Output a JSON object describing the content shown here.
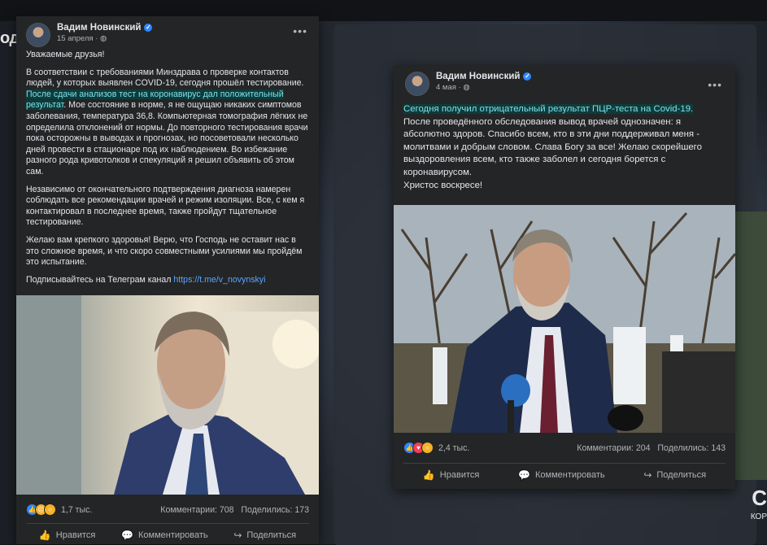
{
  "watermark_left": "ода",
  "watermark_right": {
    "big": "С",
    "small": "КОР"
  },
  "post1": {
    "author": "Вадим Новинский",
    "date": "15 апреля · ",
    "paragraphs": {
      "greeting": "Уважаемые друзья!",
      "p2_part1": "В соответствии с требованиями Минздрава о проверке контактов людей, у которых выявлен COVID-19, сегодня прошёл тестирование. ",
      "p2_highlight": "После сдачи анализов тест на коронавирус дал положительный результат",
      "p2_part2": ". Мое состояние в норме, я не ощущаю никаких симптомов заболевания, температура 36,8. Компьютерная томография лёгких не определила отклонений от нормы. До повторного тестирования врачи пока осторожны в выводах и прогнозах, но посоветовали несколько дней провести в стационаре под их наблюдением. Во избежание разного рода кривотолков и спекуляций я решил объявить об этом сам.",
      "p3": "Независимо от окончательного подтверждения диагноза намерен соблюдать все рекомендации врачей и режим изоляции. Все, с кем я контактировал в последнее время, также пройдут тщательное тестирование.",
      "p4": "Желаю вам крепкого здоровья! Верю, что Господь не оставит нас в это сложное время, и что скоро совместными усилиями мы пройдём это испытание.",
      "p5_text": "Подписывайтесь на Телеграм канал ",
      "p5_link": "https://t.me/v_novynskyi"
    },
    "reactions_count": "1,7 тыс.",
    "comments": "Комментарии: 708",
    "shares": "Поделились: 173",
    "actions": {
      "like": "Нравится",
      "comment": "Комментировать",
      "share": "Поделиться"
    }
  },
  "post2": {
    "author": "Вадим Новинский",
    "date": "4 мая · ",
    "highlight": "Сегодня получил отрицательный результат ПЦР-теста на Covid-19.",
    "text": "После проведённого обследования вывод врачей однозначен: я абсолютно здоров. Спасибо всем, кто в эти дни поддерживал меня - молитвами и добрым словом. Слава Богу за все! Желаю скорейшего выздоровления всем, кто также заболел и сегодня борется с коронавирусом.",
    "closing": "Христос воскресе!",
    "reactions_count": "2,4 тыс.",
    "comments": "Комментарии: 204",
    "shares": "Поделились: 143",
    "actions": {
      "like": "Нравится",
      "comment": "Комментировать",
      "share": "Поделиться"
    }
  },
  "icons": {
    "globe": "globe-icon",
    "more": "more-options-icon",
    "like": "thumbs-up-icon",
    "comment": "comment-icon",
    "share": "share-arrow-icon"
  },
  "colors": {
    "card_bg": "#242526",
    "text": "#e4e6eb",
    "muted": "#b0b3b8",
    "link": "#58a6ff",
    "highlight_bg": "#0e3b3b",
    "highlight_text": "#7fe0e8",
    "verified": "#2d88ff"
  }
}
